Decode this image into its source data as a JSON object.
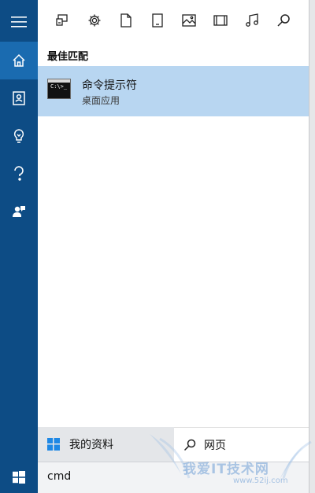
{
  "sidebar": {
    "items": [
      {
        "icon": "hamburger-menu-icon"
      },
      {
        "icon": "home-icon",
        "active": true
      },
      {
        "icon": "notebook-icon"
      },
      {
        "icon": "lightbulb-icon"
      },
      {
        "icon": "help-question-icon"
      },
      {
        "icon": "feedback-person-icon"
      }
    ]
  },
  "toolbar": {
    "filters": [
      {
        "icon": "apps-icon"
      },
      {
        "icon": "settings-gear-icon"
      },
      {
        "icon": "document-icon"
      },
      {
        "icon": "folder-icon"
      },
      {
        "icon": "photos-icon"
      },
      {
        "icon": "videos-icon"
      },
      {
        "icon": "music-icon"
      },
      {
        "icon": "search-icon"
      }
    ]
  },
  "results": {
    "section_title": "最佳匹配",
    "best_match": {
      "title": "命令提示符",
      "subtitle": "桌面应用",
      "icon_text": "C:\\>_"
    }
  },
  "bottom": {
    "my_stuff": "我的资料",
    "web": "网页"
  },
  "search": {
    "query": "cmd"
  },
  "watermark": {
    "text": "我爱IT技术网",
    "url": "www.52ij.com"
  },
  "colors": {
    "sidebar": "#0d4c85",
    "active": "#1a6bb0",
    "selection": "#b8d6f1",
    "windows_logo": "#1e88e5"
  }
}
